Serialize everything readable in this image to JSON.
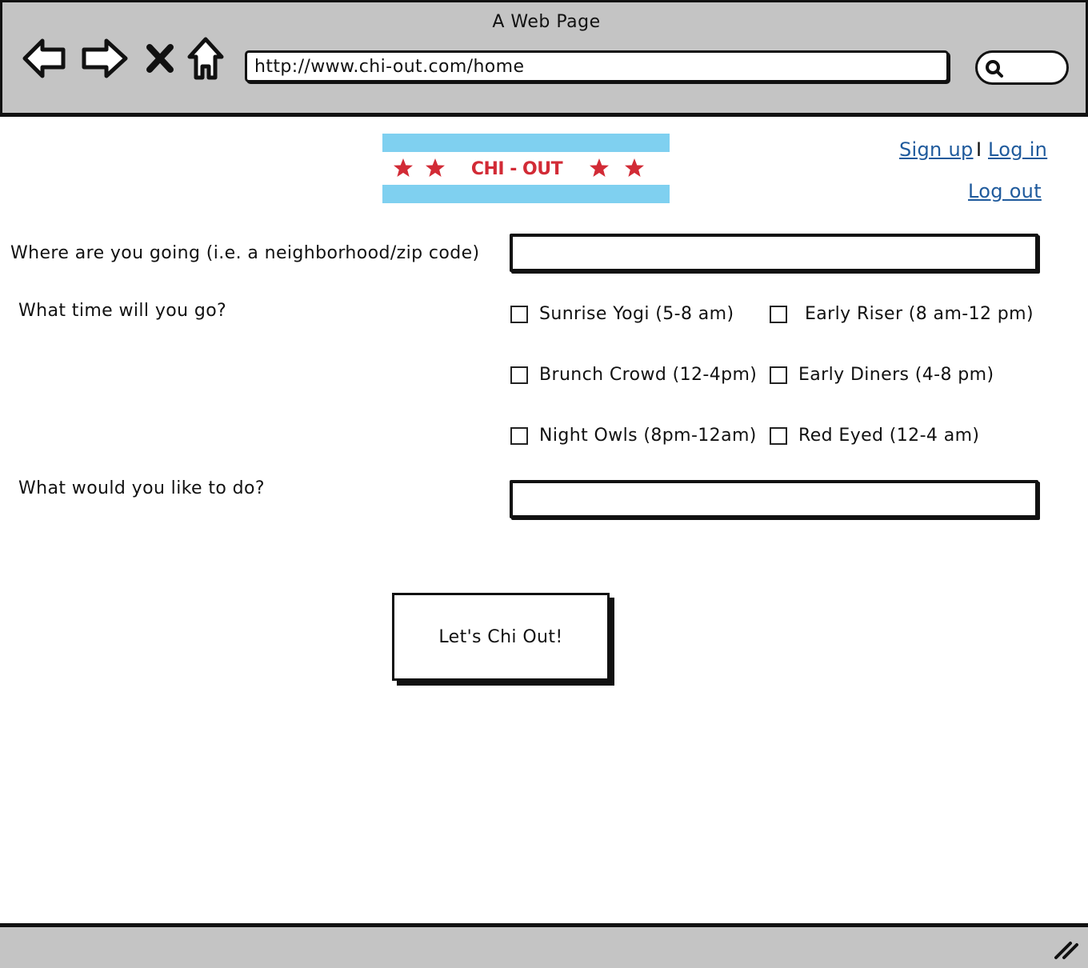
{
  "window": {
    "title": "A Web Page",
    "url": "http://www.chi-out.com/home"
  },
  "header": {
    "logo_text": "CHI - OUT",
    "sign_up": "Sign up",
    "separator": "I",
    "log_in": "Log in",
    "log_out": "Log out"
  },
  "form": {
    "where_label": "Where are you going (i.e. a neighborhood/zip code)",
    "where_value": "",
    "when_label": "What time will you go?",
    "time_options": [
      "Sunrise Yogi (5-8 am)",
      "Early Riser (8 am-12 pm)",
      "Brunch Crowd (12-4pm)",
      "Early Diners (4-8 pm)",
      "Night Owls (8pm-12am)",
      "Red Eyed (12-4 am)"
    ],
    "what_label": "What would you like to do?",
    "what_value": "",
    "submit_label": "Let's Chi Out!"
  },
  "colors": {
    "flag_blue": "#7fd0f0",
    "flag_red": "#d22b36",
    "link": "#1f5a9c",
    "chrome": "#c4c4c4"
  },
  "icons": [
    "back-arrow-icon",
    "forward-arrow-icon",
    "stop-icon",
    "home-icon",
    "search-icon",
    "resize-grip-icon"
  ]
}
